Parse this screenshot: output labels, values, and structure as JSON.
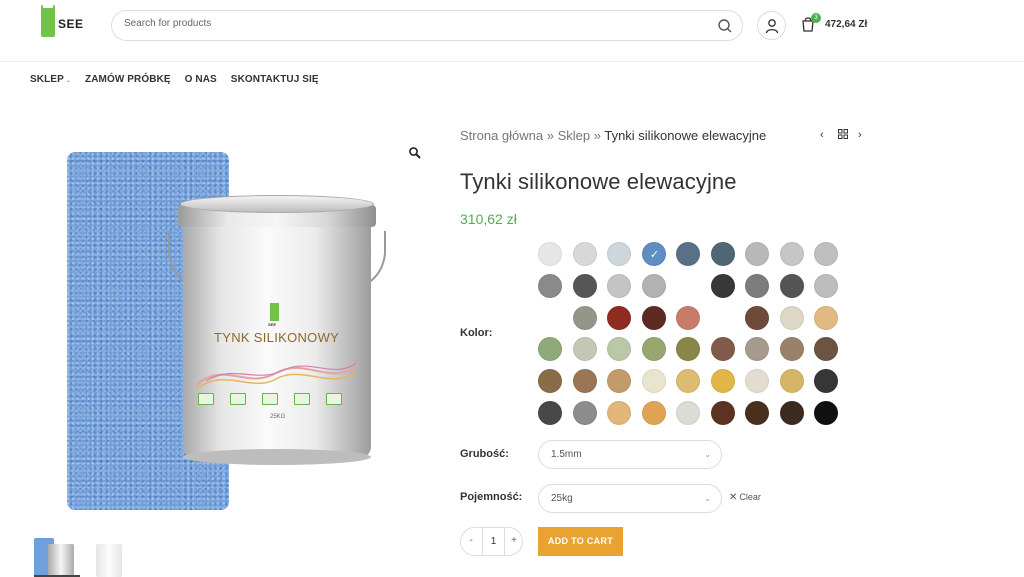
{
  "header": {
    "logo_text": "SEE",
    "search_placeholder": "Search for products",
    "cart_count": "3",
    "cart_total": "472,64 Zł"
  },
  "nav": {
    "items": [
      {
        "label": "SKLEP"
      },
      {
        "label": "ZAMÓW PRÓBKĘ"
      },
      {
        "label": "O NAS"
      },
      {
        "label": "SKONTAKTUJ SIĘ"
      }
    ]
  },
  "product_image": {
    "bucket_title": "TYNK SILIKONOWY",
    "bucket_logo": "SEE",
    "bucket_weight": "25KG"
  },
  "breadcrumb": {
    "home": "Strona główna",
    "sep1": " » ",
    "shop": "Sklep",
    "sep2": " » ",
    "current": "Tynki silikonowe elewacyjne"
  },
  "product": {
    "title": "Tynki silikonowe elewacyjne",
    "price": "310,62 zł"
  },
  "options": {
    "color_label": "Kolor:",
    "thickness_label": "Grubość:",
    "thickness_value": "1.5mm",
    "capacity_label": "Pojemność:",
    "capacity_value": "25kg",
    "clear_label": "Clear",
    "swatch_colors": [
      [
        "#e6e6e6",
        "#d8d8d8",
        "#ccd6dc",
        "#5f8ec2",
        "#5a7086",
        "#4f6675",
        "#b8b8b8",
        "#c6c6c6",
        "#bfbfbf"
      ],
      [
        "#8a8a8a",
        "#565656",
        "#c4c4c4",
        "#b2b2b2",
        null,
        "#383838",
        "#7c7c7c",
        "#545454",
        "#bdbdbd"
      ],
      [
        null,
        "#94968a",
        "#8f2c22",
        "#5c2a22",
        "#c97b69",
        null,
        "#6d4a3a",
        "#ddd8c6",
        "#e0b983"
      ],
      [
        "#8daa78",
        "#c3c8b6",
        "#b9c8a6",
        "#98a670",
        "#8a8548",
        "#805b4a",
        "#a59a8c",
        "#98836a",
        "#6b5442"
      ],
      [
        "#8a6c48",
        "#9a7654",
        "#c39a6c",
        "#e9e4cc",
        "#dcbc70",
        "#e2b646",
        "#e4dccf",
        "#d4b666",
        "#363636"
      ],
      [
        "#484848",
        "#8c8c8c",
        "#e2b679",
        "#e0a356",
        "#dcdcd4",
        "#5d3220",
        "#4a2e1e",
        "#3c2a1e",
        "#101010"
      ]
    ],
    "selected_swatch": "0,3"
  },
  "cart_form": {
    "quantity": "1",
    "minus": "-",
    "plus": "+",
    "add_label": "ADD TO CART"
  }
}
